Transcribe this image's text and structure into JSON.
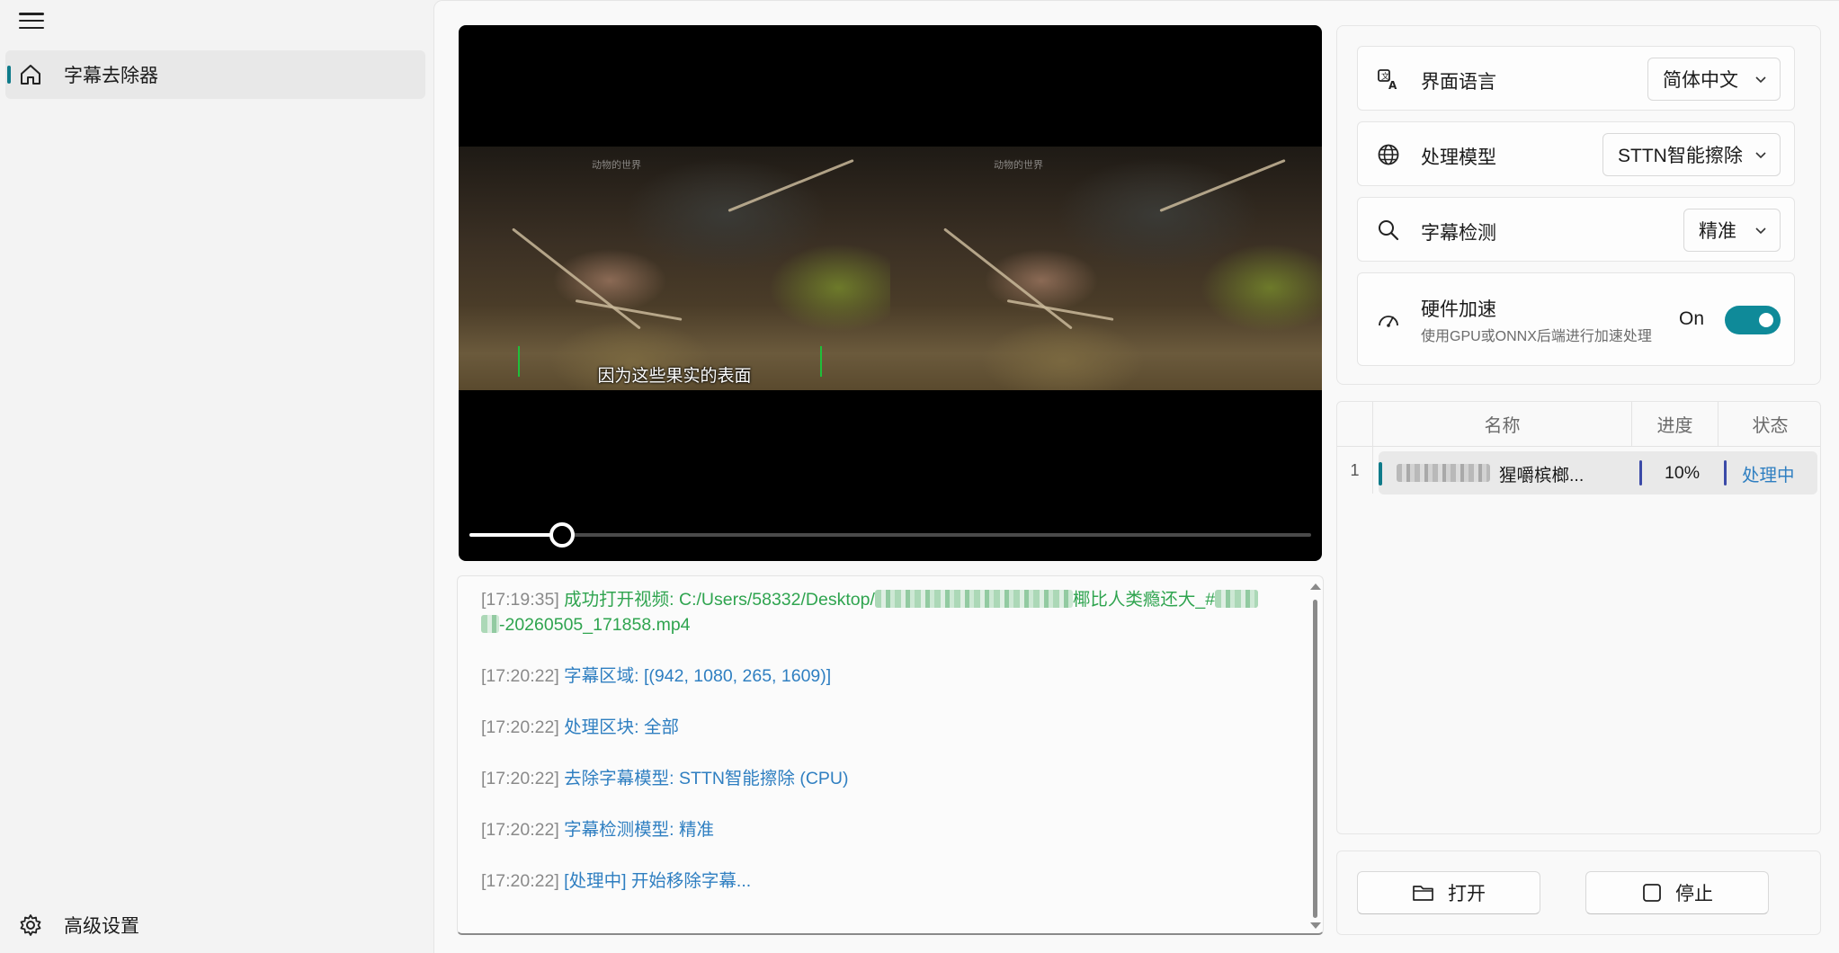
{
  "sidebar": {
    "items": [
      {
        "label": "字幕去除器",
        "icon": "home-icon",
        "active": true
      }
    ],
    "footer": {
      "label": "高级设置",
      "icon": "gear-icon"
    }
  },
  "video": {
    "watermark": "动物的世界",
    "subtitle": "因为这些果实的表面",
    "progress": 0.11
  },
  "log": {
    "entries": [
      {
        "time": "[17:20:22]",
        "text": "字幕区域: [(942, 1080, 265, 1609)]",
        "color": "blue"
      },
      {
        "time": "[17:20:22]",
        "text": "处理区块: 全部",
        "color": "blue"
      },
      {
        "time": "[17:20:22]",
        "text": "去除字幕模型: STTN智能擦除 (CPU)",
        "color": "blue"
      },
      {
        "time": "[17:20:22]",
        "text": "字幕检测模型: 精准",
        "color": "blue"
      },
      {
        "time": "[17:20:22]",
        "text": "[处理中] 开始移除字幕...",
        "color": "blue"
      }
    ],
    "first": {
      "time": "[17:19:35]",
      "prefix": "成功打开视频: C:/Users/58332/Desktop/",
      "mid": "椰比人类瘾还大_#",
      "suffix": "-20260505_171858.mp4"
    }
  },
  "settings": {
    "language": {
      "title": "界面语言",
      "value": "简体中文",
      "icon": "language-icon"
    },
    "model": {
      "title": "处理模型",
      "value": "STTN智能擦除",
      "icon": "globe-icon"
    },
    "detection": {
      "title": "字幕检测",
      "value": "精准",
      "icon": "search-icon"
    },
    "hardware": {
      "title": "硬件加速",
      "desc": "使用GPU或ONNX后端进行加速处理",
      "state_label": "On",
      "enabled": true,
      "icon": "speedometer-icon"
    }
  },
  "table": {
    "headers": {
      "name": "名称",
      "progress": "进度",
      "status": "状态"
    },
    "rows": [
      {
        "index": "1",
        "name": "猩嚼槟榔...",
        "progress": "10%",
        "status": "处理中"
      }
    ]
  },
  "actions": {
    "open_label": "打开",
    "stop_label": "停止"
  },
  "colors": {
    "accent": "#0f8a99",
    "log_green": "#2fa44f",
    "log_blue": "#2f7fc1"
  }
}
